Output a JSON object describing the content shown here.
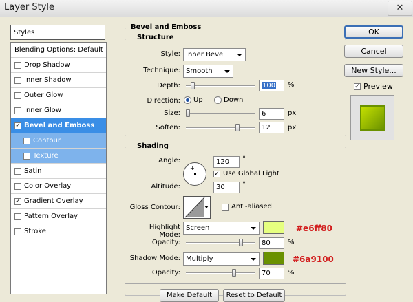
{
  "window": {
    "title": "Layer Style",
    "close_glyph": "✕"
  },
  "sidebar": {
    "header": "Styles",
    "items": [
      {
        "label": "Blending Options: Default",
        "checkbox": false,
        "checked": false,
        "state": "normal"
      },
      {
        "label": "Drop Shadow",
        "checkbox": true,
        "checked": false,
        "state": "normal"
      },
      {
        "label": "Inner Shadow",
        "checkbox": true,
        "checked": false,
        "state": "normal"
      },
      {
        "label": "Outer Glow",
        "checkbox": true,
        "checked": false,
        "state": "normal"
      },
      {
        "label": "Inner Glow",
        "checkbox": true,
        "checked": false,
        "state": "normal"
      },
      {
        "label": "Bevel and Emboss",
        "checkbox": true,
        "checked": true,
        "state": "selected"
      },
      {
        "label": "Contour",
        "checkbox": true,
        "checked": false,
        "state": "sub"
      },
      {
        "label": "Texture",
        "checkbox": true,
        "checked": false,
        "state": "sub"
      },
      {
        "label": "Satin",
        "checkbox": true,
        "checked": false,
        "state": "normal"
      },
      {
        "label": "Color Overlay",
        "checkbox": true,
        "checked": false,
        "state": "normal"
      },
      {
        "label": "Gradient Overlay",
        "checkbox": true,
        "checked": true,
        "state": "normal"
      },
      {
        "label": "Pattern Overlay",
        "checkbox": true,
        "checked": false,
        "state": "normal"
      },
      {
        "label": "Stroke",
        "checkbox": true,
        "checked": false,
        "state": "normal"
      }
    ]
  },
  "bevel": {
    "title": "Bevel and Emboss",
    "structure": {
      "title": "Structure",
      "style_label": "Style:",
      "style_value": "Inner Bevel",
      "technique_label": "Technique:",
      "technique_value": "Smooth",
      "depth_label": "Depth:",
      "depth_value": "100",
      "depth_unit": "%",
      "depth_level": 0.1,
      "direction_label": "Direction:",
      "direction_up": "Up",
      "direction_down": "Down",
      "direction_selected": "Up",
      "size_label": "Size:",
      "size_value": "6",
      "size_unit": "px",
      "size_level": 0.03,
      "soften_label": "Soften:",
      "soften_value": "12",
      "soften_unit": "px",
      "soften_level": 0.75
    },
    "shading": {
      "title": "Shading",
      "angle_label": "Angle:",
      "angle_value": "120",
      "angle_unit": "°",
      "global_light_label": "Use Global Light",
      "global_light_checked": true,
      "altitude_label": "Altitude:",
      "altitude_value": "30",
      "altitude_unit": "°",
      "gloss_label": "Gloss Contour:",
      "antialiased_label": "Anti-aliased",
      "antialiased_checked": false,
      "highlight_label": "Highlight Mode:",
      "highlight_mode": "Screen",
      "highlight_color": "#e6ff80",
      "highlight_hex": "#e6ff80",
      "highlight_opacity_label": "Opacity:",
      "highlight_opacity_value": "80",
      "highlight_opacity_unit": "%",
      "highlight_opacity_level": 0.8,
      "shadow_label": "Shadow Mode:",
      "shadow_mode": "Multiply",
      "shadow_color": "#6a9100",
      "shadow_hex": "#6a9100",
      "shadow_opacity_label": "Opacity:",
      "shadow_opacity_value": "70",
      "shadow_opacity_unit": "%",
      "shadow_opacity_level": 0.7
    },
    "bottom_buttons": {
      "make_default": "Make Default",
      "reset_default": "Reset to Default"
    }
  },
  "actions": {
    "ok": "OK",
    "cancel": "Cancel",
    "new_style": "New Style...",
    "preview_label": "Preview",
    "preview_checked": true
  },
  "colors": {
    "selection": "#3a8ee6",
    "preview_light": "#c5e000",
    "preview_dark": "#6a9100"
  }
}
